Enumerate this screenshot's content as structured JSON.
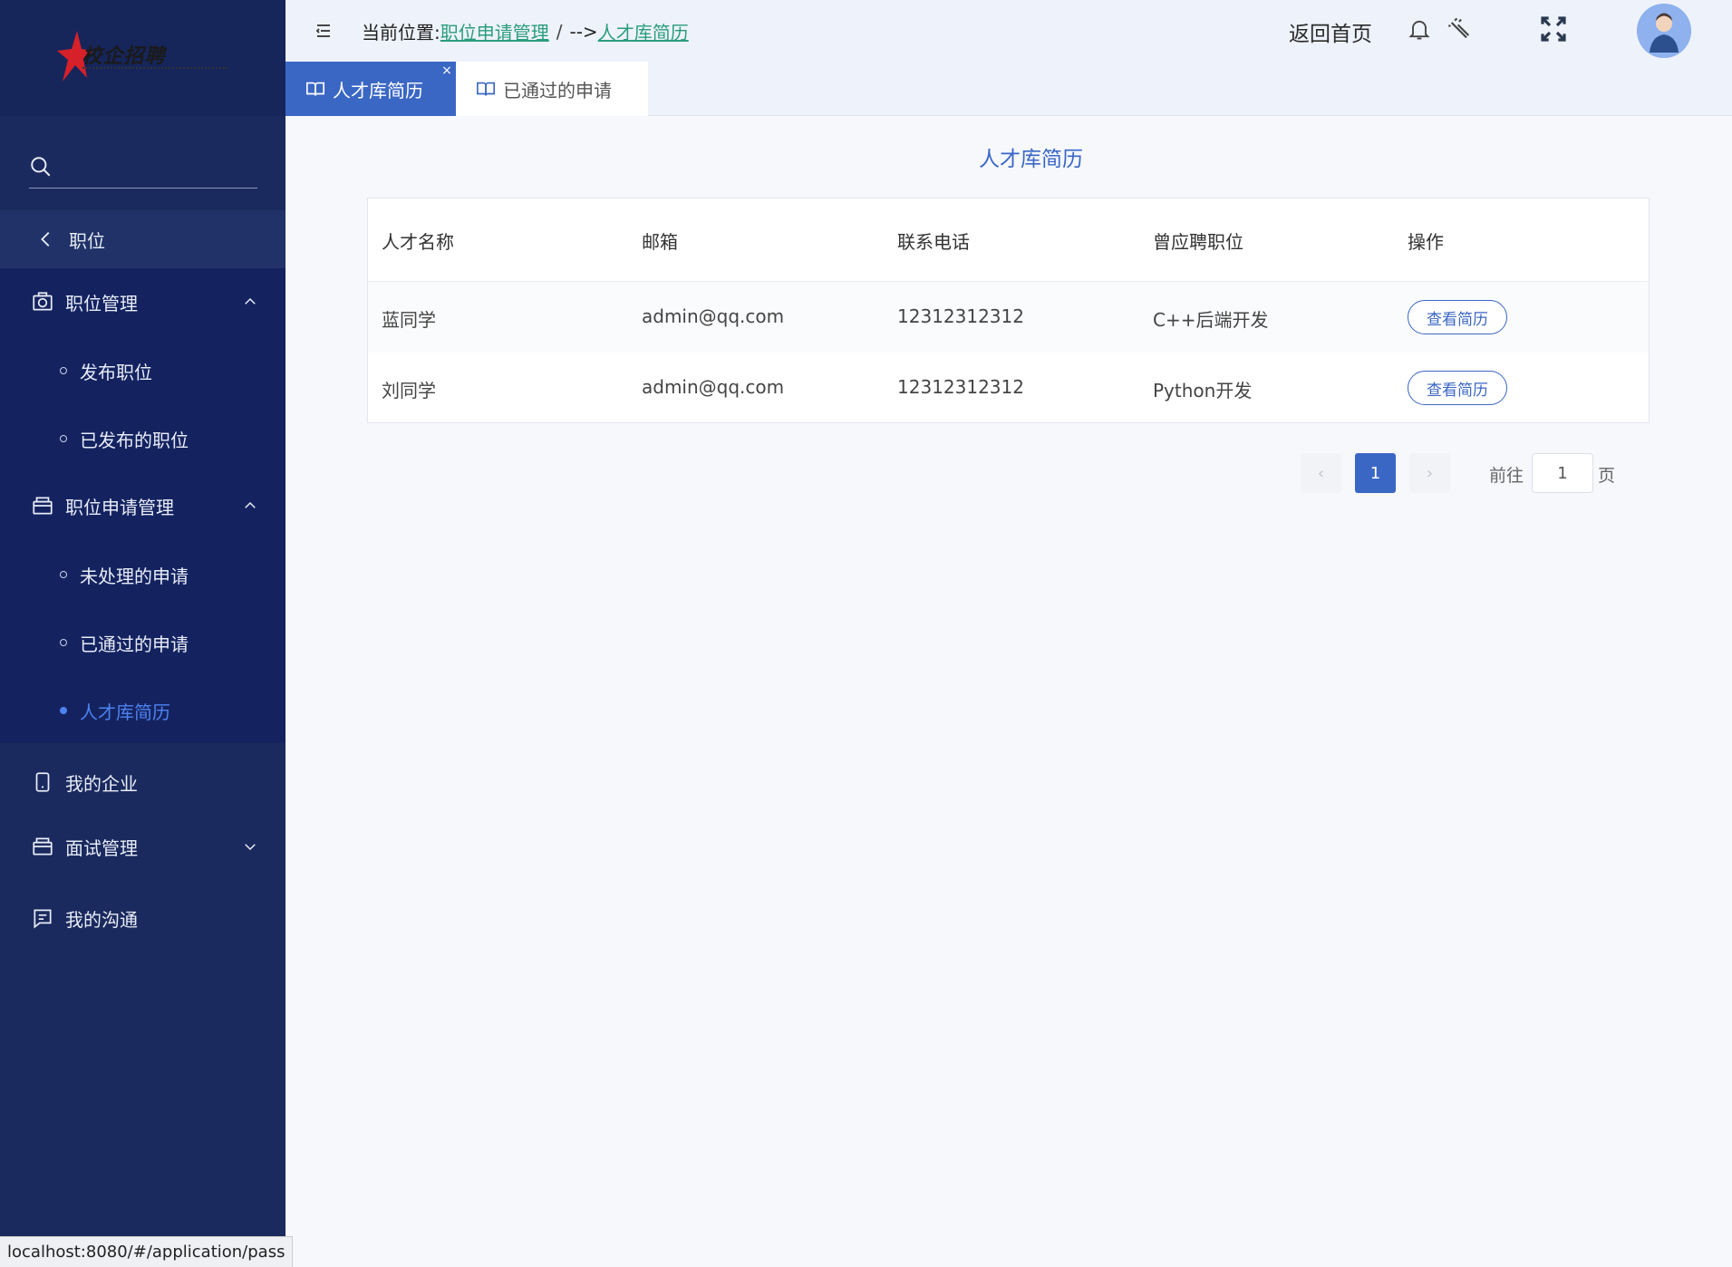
{
  "sidebar": {
    "logo_text": "校企招聘",
    "search_placeholder": "",
    "back_label": "职位",
    "groups": [
      {
        "label": "职位管理",
        "icon": "camera-icon",
        "expanded": true,
        "items": [
          {
            "label": "发布职位"
          },
          {
            "label": "已发布的职位"
          }
        ]
      },
      {
        "label": "职位申请管理",
        "icon": "briefcase-icon",
        "expanded": true,
        "items": [
          {
            "label": "未处理的申请"
          },
          {
            "label": "已通过的申请"
          },
          {
            "label": "人才库简历",
            "active": true
          }
        ]
      }
    ],
    "menu": [
      {
        "label": "我的企业",
        "icon": "phone-icon"
      },
      {
        "label": "面试管理",
        "icon": "briefcase-icon"
      },
      {
        "label": "我的沟通",
        "icon": "chat-icon"
      }
    ]
  },
  "header": {
    "crumb_prefix": "当前位置:",
    "crumb_parent": "职位申请管理",
    "crumb_sep": "/",
    "crumb_arrow": "-->",
    "crumb_current": "人才库简历",
    "home_label": "返回首页"
  },
  "tabs": [
    {
      "label": "人才库简历",
      "active": true,
      "close": "×"
    },
    {
      "label": "已通过的申请",
      "active": false
    }
  ],
  "main": {
    "title": "人才库简历",
    "columns": [
      "人才名称",
      "邮箱",
      "联系电话",
      "曾应聘职位",
      "操作"
    ],
    "rows": [
      {
        "name": "蓝同学",
        "email": "admin@qq.com",
        "phone": "12312312312",
        "position": "C++后端开发",
        "action": "查看简历"
      },
      {
        "name": "刘同学",
        "email": "admin@qq.com",
        "phone": "12312312312",
        "position": "Python开发",
        "action": "查看简历"
      }
    ],
    "pagination": {
      "prev": "‹",
      "current": "1",
      "next": "›",
      "goto_label": "前往",
      "goto_value": "1",
      "unit": "页"
    }
  },
  "status_url": "localhost:8080/#/application/pass",
  "colors": {
    "sidebar": "#1a2a5e",
    "accent": "#3b67c4",
    "link": "#2a9d7f"
  }
}
